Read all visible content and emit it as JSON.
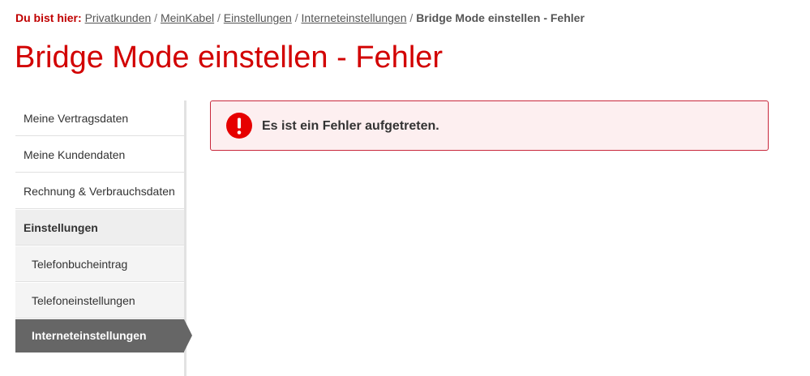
{
  "breadcrumb": {
    "prefix": "Du bist hier:",
    "items": [
      "Privatkunden",
      "MeinKabel",
      "Einstellungen",
      "Interneteinstellungen"
    ],
    "separator": "/",
    "current": "Bridge Mode einstellen - Fehler"
  },
  "page": {
    "title": "Bridge Mode einstellen - Fehler"
  },
  "sidebar": {
    "items": [
      {
        "label": "Meine Vertragsdaten"
      },
      {
        "label": "Meine Kundendaten"
      },
      {
        "label": "Rechnung & Verbrauchsdaten"
      },
      {
        "label": "Einstellungen"
      },
      {
        "label": "Telefonbucheintrag"
      },
      {
        "label": "Telefoneinstellungen"
      },
      {
        "label": "Interneteinstellungen"
      }
    ]
  },
  "alert": {
    "message": "Es ist ein Fehler aufgetreten.",
    "icon": "error-icon"
  },
  "colors": {
    "brand_red": "#d20000",
    "alert_border": "#c8283c",
    "alert_bg": "#fdeff0",
    "icon_red": "#e60000"
  }
}
